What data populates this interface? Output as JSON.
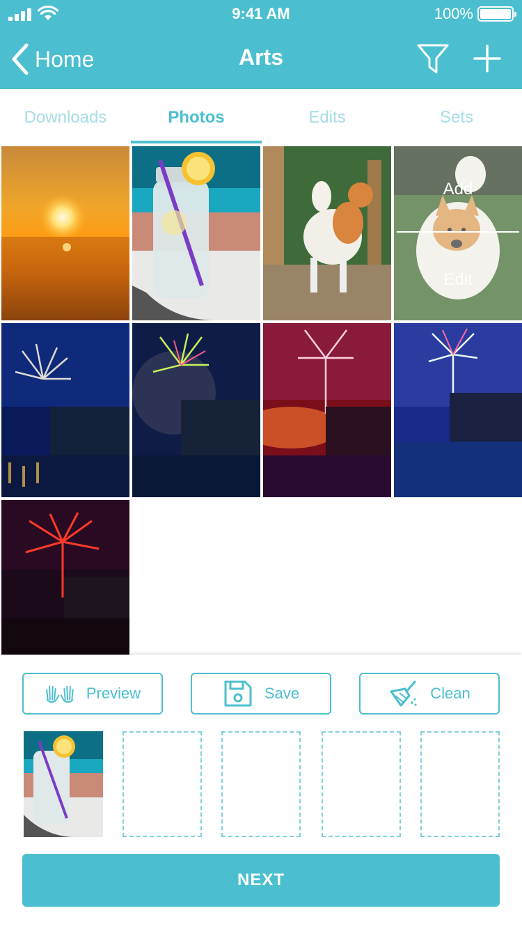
{
  "status_bar": {
    "time": "9:41 AM",
    "battery": "100%"
  },
  "nav": {
    "back_label": "Home",
    "title": "Arts",
    "filter_icon": "filter-icon",
    "add_icon": "plus-icon"
  },
  "tabs": [
    {
      "label": "Downloads",
      "active": false
    },
    {
      "label": "Photos",
      "active": true
    },
    {
      "label": "Edits",
      "active": false
    },
    {
      "label": "Sets",
      "active": false
    }
  ],
  "photos": [
    "sunset-over-sea",
    "lemon-water-jar",
    "dog-in-garden",
    "dog-on-grass",
    "fireworks-white-blue",
    "fireworks-green",
    "fireworks-red-pink",
    "fireworks-pink-blue",
    "fireworks-red"
  ],
  "overlay_menu": {
    "add_label": "Add",
    "edit_label": "Edit"
  },
  "actions": {
    "preview_label": "Preview",
    "save_label": "Save",
    "clean_label": "Clean"
  },
  "next_label": "NEXT",
  "colors": {
    "accent": "#4bbfcf",
    "accent_light": "#a6dde5"
  }
}
